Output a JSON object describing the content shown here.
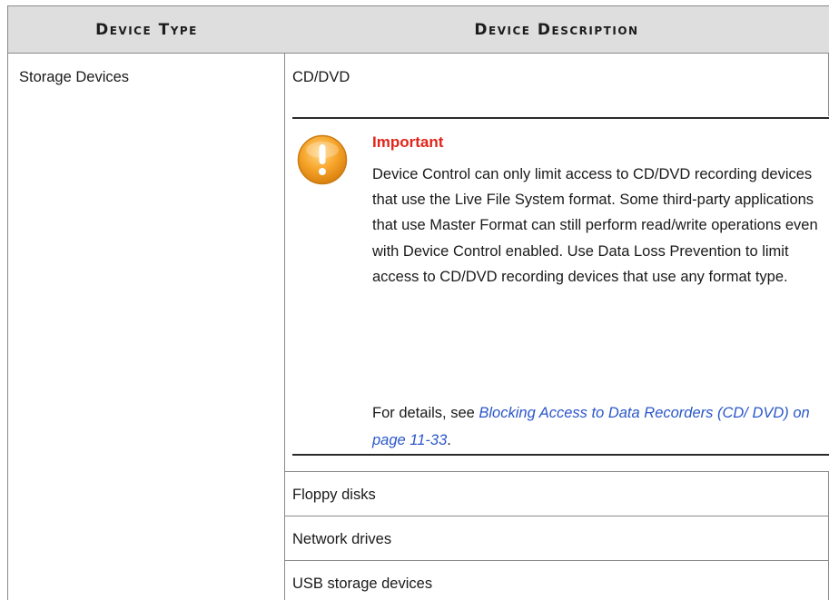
{
  "table": {
    "headers": {
      "type": "Device Type",
      "description": "Device Description"
    },
    "type_cell": "Storage Devices",
    "rows": {
      "cd_dvd": "CD/DVD",
      "floppy": "Floppy disks",
      "network": "Network drives",
      "usb": "USB storage devices"
    }
  },
  "important": {
    "title": "Important",
    "body": "Device Control can only limit access to CD/DVD recording devices that use the Live File System format. Some third-party applications that use Master Format can still perform read/write operations even with Device Control enabled. Use Data Loss Prevention to limit access to CD/DVD recording devices that use any format type.",
    "details_prefix": "For details, see ",
    "link_text": "Blocking Access to Data Recorders (CD/ DVD) on page 11-33",
    "details_suffix": "."
  },
  "icons": {
    "warning": "warning-icon"
  },
  "colors": {
    "header_bg": "#dedede",
    "important_title": "#e1251b",
    "link": "#2b57c9",
    "warning_icon": "#f5a623"
  }
}
